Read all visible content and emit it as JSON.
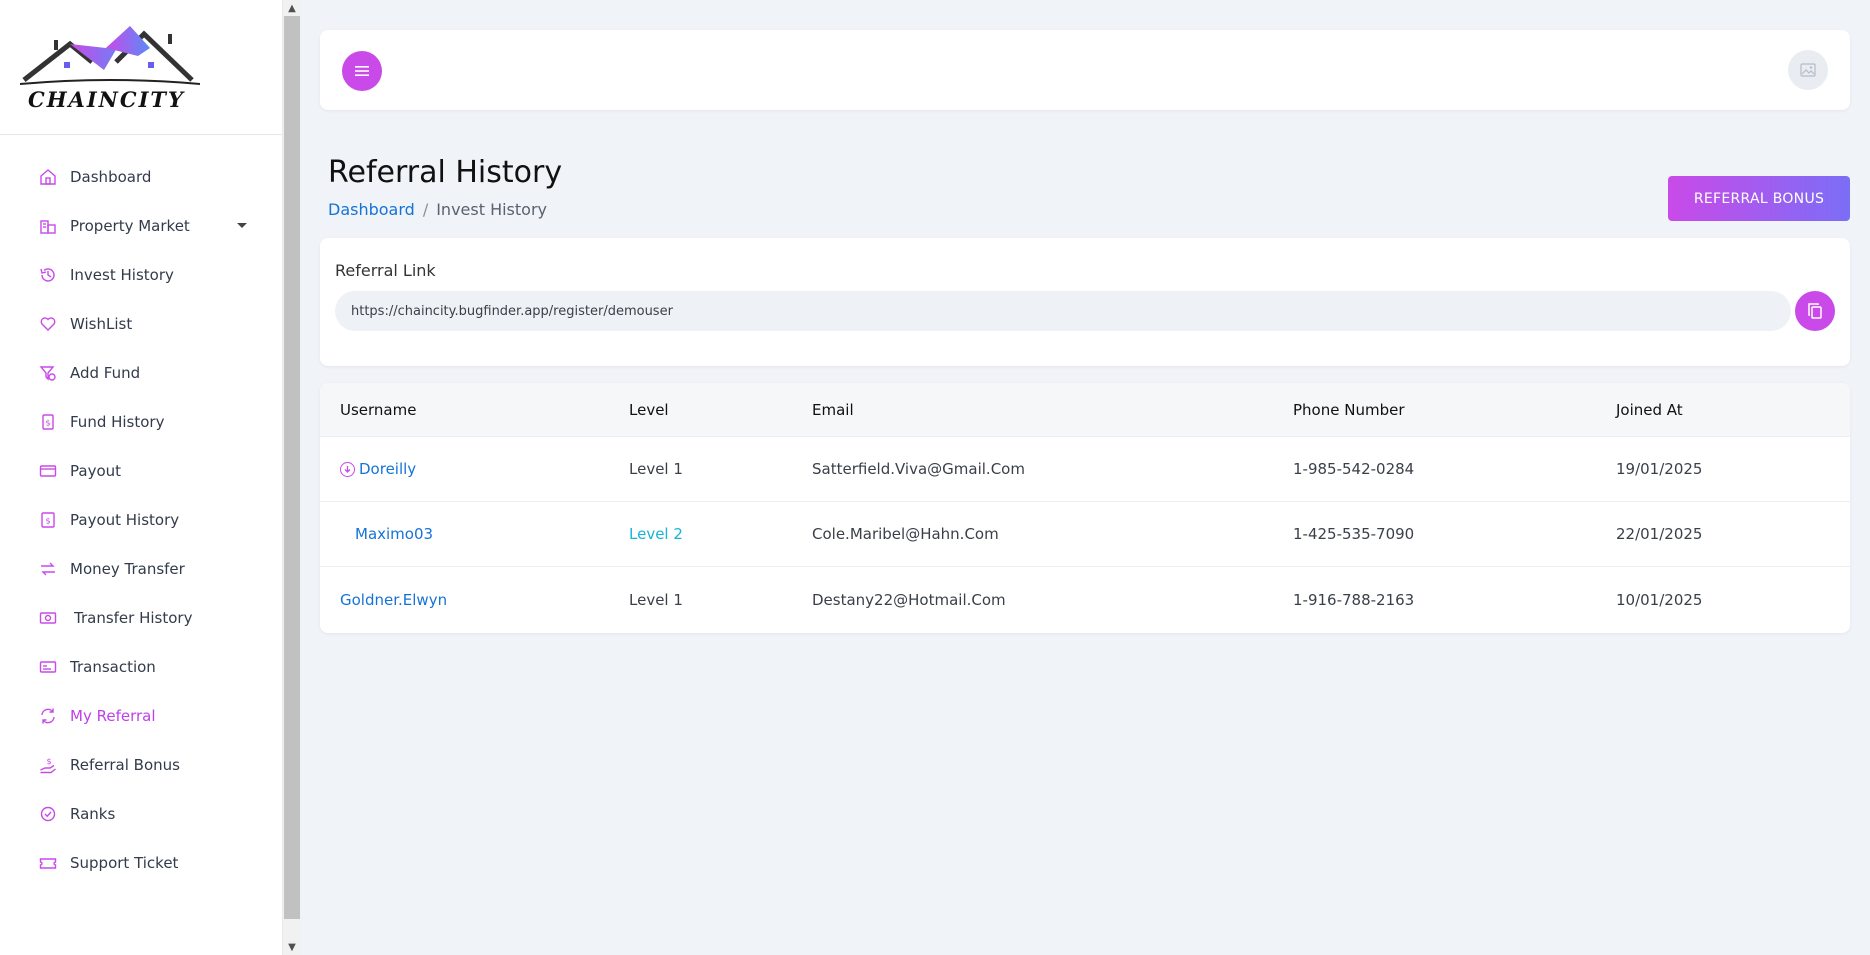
{
  "brand": {
    "name": "CHAINCITY"
  },
  "sidebar": {
    "items": [
      {
        "label": "Dashboard",
        "icon": "home-icon"
      },
      {
        "label": "Property Market",
        "icon": "building-icon",
        "has_dropdown": true
      },
      {
        "label": "Invest History",
        "icon": "history-icon"
      },
      {
        "label": "WishList",
        "icon": "heart-icon"
      },
      {
        "label": "Add Fund",
        "icon": "add-fund-icon"
      },
      {
        "label": "Fund History",
        "icon": "fund-history-icon"
      },
      {
        "label": "Payout",
        "icon": "card-icon"
      },
      {
        "label": "Payout History",
        "icon": "payout-history-icon"
      },
      {
        "label": "Money Transfer",
        "icon": "transfer-icon"
      },
      {
        "label": "Transfer History",
        "icon": "money-icon"
      },
      {
        "label": "Transaction",
        "icon": "transaction-icon"
      },
      {
        "label": "My Referral",
        "icon": "referral-icon",
        "active": true
      },
      {
        "label": "Referral Bonus",
        "icon": "bonus-icon"
      },
      {
        "label": "Ranks",
        "icon": "rank-icon"
      },
      {
        "label": "Support Ticket",
        "icon": "ticket-icon"
      }
    ]
  },
  "header": {
    "title": "Referral History",
    "breadcrumb": {
      "home": "Dashboard",
      "separator": "/",
      "current": "Invest History"
    },
    "bonus_button": "REFERRAL BONUS"
  },
  "referral": {
    "label": "Referral Link",
    "url": "https://chaincity.bugfinder.app/register/demouser"
  },
  "table": {
    "columns": [
      "Username",
      "Level",
      "Email",
      "Phone Number",
      "Joined At"
    ],
    "rows": [
      {
        "username": "Doreilly",
        "level": "Level 1",
        "email": "Satterfield.Viva@Gmail.Com",
        "phone": "1-985-542-0284",
        "joined": "19/01/2025",
        "expandable": true
      },
      {
        "username": "Maximo03",
        "level": "Level 2",
        "email": "Cole.Maribel@Hahn.Com",
        "phone": "1-425-535-7090",
        "joined": "22/01/2025",
        "nested": true
      },
      {
        "username": "Goldner.Elwyn",
        "level": "Level 1",
        "email": "Destany22@Hotmail.Com",
        "phone": "1-916-788-2163",
        "joined": "10/01/2025"
      }
    ]
  },
  "colors": {
    "accent": "#c94ae8",
    "link": "#1673d6",
    "level2": "#16b4d8",
    "background": "#f0f3f8"
  }
}
